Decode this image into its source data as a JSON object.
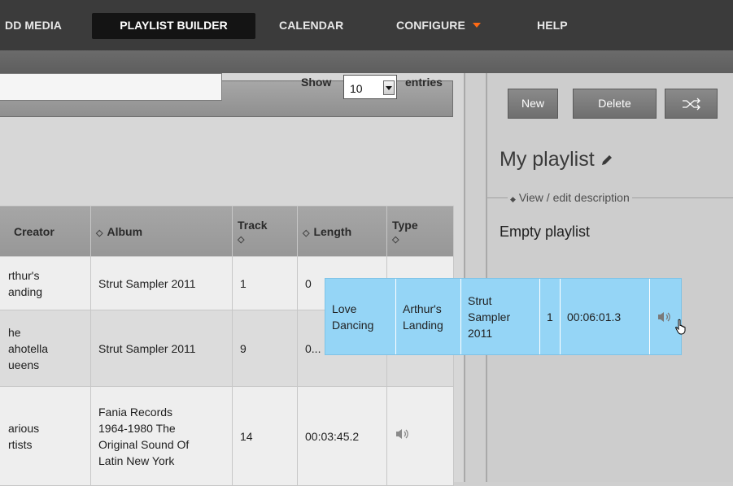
{
  "nav": {
    "item_add_media": "DD MEDIA",
    "item_playlist_builder": "PLAYLIST BUILDER",
    "item_calendar": "CALENDAR",
    "item_configure": "CONFIGURE",
    "item_help": "HELP"
  },
  "library": {
    "show_label": "Show",
    "show_value": "10",
    "entries_label": "entries",
    "columns": {
      "creator": "Creator",
      "album": "Album",
      "track": "Track",
      "length": "Length",
      "type": "Type"
    },
    "rows": [
      {
        "creator_line1": "rthur's",
        "creator_line2": "anding",
        "album": "Strut Sampler 2011",
        "track": "1",
        "length": "0"
      },
      {
        "creator_line1": "he",
        "creator_line2": "ahotella",
        "creator_line3": "ueens",
        "album": "Strut Sampler 2011",
        "track": "9",
        "length": "0..."
      },
      {
        "creator_line1": "arious",
        "creator_line2": "rtists",
        "album_line1": "Fania Records",
        "album_line2": "1964-1980 The",
        "album_line3": "Original Sound Of",
        "album_line4": "Latin New York",
        "track": "14",
        "length": "00:03:45.2"
      }
    ]
  },
  "playlist": {
    "new_label": "New",
    "delete_label": "Delete",
    "title": "My playlist",
    "description_toggle": "View / edit description",
    "empty_text": "Empty playlist"
  },
  "drag_item": {
    "title_line1": "Love",
    "title_line2": "Dancing",
    "creator_line1": "Arthur's",
    "creator_line2": "Landing",
    "album_line1": "Strut",
    "album_line2": "Sampler",
    "album_line3": "2011",
    "track": "1",
    "length": "00:06:01.3"
  },
  "colors": {
    "nav_bg": "#3b3b3b",
    "accent_caret": "#ff6a14",
    "drag_highlight": "#95d5f6"
  }
}
